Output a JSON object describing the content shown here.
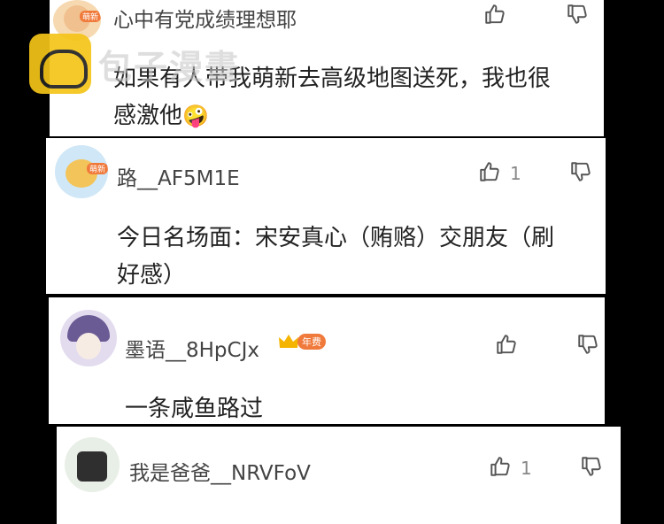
{
  "comments": [
    {
      "username": "心中有党成绩理想耶",
      "avatar_badge": "萌新",
      "content_lines": [
        "如果有人带我萌新去高级地图送死，我也很",
        "感激他"
      ],
      "emoji": "🤪",
      "likes": ""
    },
    {
      "username": "路__AF5M1E",
      "avatar_badge": "萌新",
      "content_lines": [
        "今日名场面：宋安真心（贿赂）交朋友（刷",
        "好感）"
      ],
      "likes": "1"
    },
    {
      "username": "墨语__8HpCJx",
      "user_badge": "年费",
      "content_lines": [
        "一条咸鱼路过"
      ],
      "likes": ""
    },
    {
      "username": "我是爸爸__NRVFoV",
      "content_lines": [],
      "likes": "1"
    }
  ],
  "watermark": {
    "text": "包子漫畫",
    "icon": "bun-logo-icon"
  },
  "icons": {
    "like": "thumbs-up-icon",
    "dislike": "thumbs-down-icon"
  },
  "colors": {
    "badge": "#f07a3b",
    "watermark_logo": "#f5c518"
  }
}
